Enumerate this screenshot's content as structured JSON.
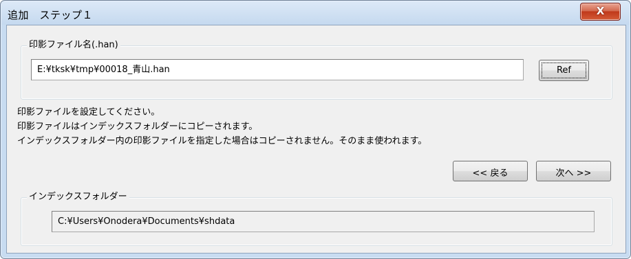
{
  "window": {
    "title": "追加　ステップ１",
    "close_label": "X"
  },
  "file_group": {
    "legend": "印影ファイル名(.han)",
    "value": "E:¥tksk¥tmp¥00018_青山.han",
    "ref_label": "Ref"
  },
  "messages": [
    "印影ファイルを設定してください。",
    "印影ファイルはインデックスフォルダーにコピーされます。",
    "インデックスフォルダー内の印影ファイルを指定した場合はコピーされません。そのまま使われます。"
  ],
  "nav": {
    "back_label": "<< 戻る",
    "next_label": "次へ >>"
  },
  "index_group": {
    "legend": "インデックスフォルダー",
    "value": "C:¥Users¥Onodera¥Documents¥shdata"
  },
  "colors": {
    "title_bg": "#c8dcf1",
    "client_bg": "#f0f0f0",
    "close_red": "#c0391b"
  }
}
